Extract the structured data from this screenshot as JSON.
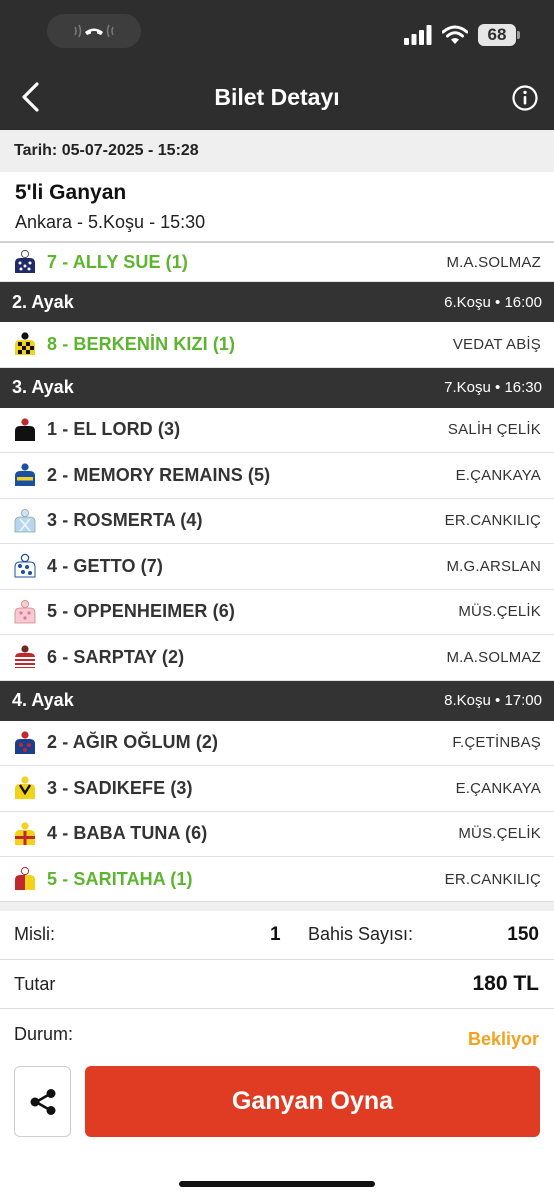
{
  "header": {
    "title": "Bilet Detayı"
  },
  "status_bar": {
    "battery": "68"
  },
  "date_row": "Tarih: 05-07-2025 - 15:28",
  "ticket": {
    "title": "5'li Ganyan",
    "subtitle": "Ankara - 5.Koşu - 15:30"
  },
  "first_leg_partial": {
    "horse": "7 - ALLY SUE (1)",
    "jockey": "M.A.SOLMAZ",
    "winner": true,
    "jersey_icon": "jersey-navy-dots-icon"
  },
  "legs": [
    {
      "title": "2. Ayak",
      "race": "6.Koşu • 16:00",
      "horses": [
        {
          "name": "8 - BERKENİN KIZI (1)",
          "jockey": "VEDAT ABİŞ",
          "winner": true,
          "jersey_icon": "jersey-yellow-check-icon"
        }
      ]
    },
    {
      "title": "3. Ayak",
      "race": "7.Koşu • 16:30",
      "horses": [
        {
          "name": "1 - EL LORD (3)",
          "jockey": "SALİH ÇELİK",
          "winner": false,
          "jersey_icon": "jersey-black-red-icon"
        },
        {
          "name": "2 - MEMORY REMAINS (5)",
          "jockey": "E.ÇANKAYA",
          "winner": false,
          "jersey_icon": "jersey-blue-yellow-icon"
        },
        {
          "name": "3 - ROSMERTA (4)",
          "jockey": "ER.CANKILIÇ",
          "winner": false,
          "jersey_icon": "jersey-lightblue-icon"
        },
        {
          "name": "4 - GETTO (7)",
          "jockey": "M.G.ARSLAN",
          "winner": false,
          "jersey_icon": "jersey-blue-white-dots-icon"
        },
        {
          "name": "5 - OPPENHEIMER (6)",
          "jockey": "MÜS.ÇELİK",
          "winner": false,
          "jersey_icon": "jersey-pink-icon"
        },
        {
          "name": "6 - SARPTAY (2)",
          "jockey": "M.A.SOLMAZ",
          "winner": false,
          "jersey_icon": "jersey-red-white-stripes-icon"
        }
      ]
    },
    {
      "title": "4. Ayak",
      "race": "8.Koşu • 17:00",
      "horses": [
        {
          "name": "2 - AĞIR OĞLUM (2)",
          "jockey": "F.ÇETİNBAŞ",
          "winner": false,
          "jersey_icon": "jersey-blue-red-icon"
        },
        {
          "name": "3 - SADIKEFE (3)",
          "jockey": "E.ÇANKAYA",
          "winner": false,
          "jersey_icon": "jersey-yellow-black-icon"
        },
        {
          "name": "4 - BABA TUNA (6)",
          "jockey": "MÜS.ÇELİK",
          "winner": false,
          "jersey_icon": "jersey-yellow-red-icon"
        },
        {
          "name": "5 - SARITAHA (1)",
          "jockey": "ER.CANKILIÇ",
          "winner": true,
          "jersey_icon": "jersey-red-yellow-icon"
        }
      ]
    }
  ],
  "summary": {
    "misli_label": "Misli:",
    "misli_value": "1",
    "bahis_label": "Bahis Sayısı:",
    "bahis_value": "150",
    "tutar_label": "Tutar",
    "tutar_value": "180 TL",
    "durum_label": "Durum:",
    "durum_value": "Bekliyor"
  },
  "actions": {
    "play_label": "Ganyan Oyna"
  },
  "colors": {
    "header_bg": "#2e2e2e",
    "winner_green": "#5bb52d",
    "pending_orange": "#f5a11c",
    "play_red": "#e03c23"
  }
}
